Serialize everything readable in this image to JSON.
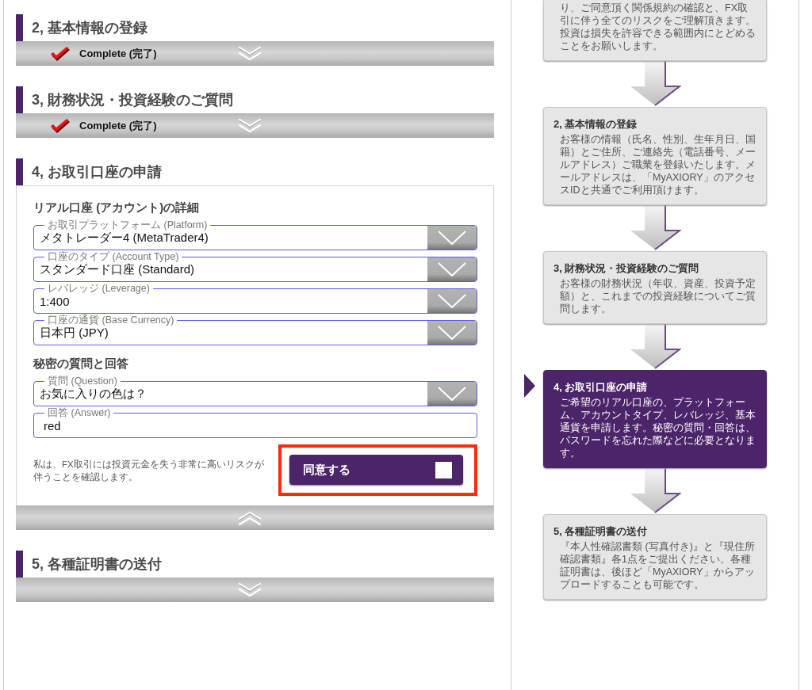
{
  "sections": [
    {
      "title": "2, 基本情報の登録",
      "expanded": false,
      "complete": true,
      "status": "Complete (完了)"
    },
    {
      "title": "3, 財務状況・投資経験のご質問",
      "expanded": false,
      "complete": true,
      "status": "Complete (完了)"
    },
    {
      "title": "4, お取引口座の申請",
      "expanded": true,
      "complete": false,
      "form": {
        "groups": [
          {
            "heading": "リアル口座 (アカウント)の詳細",
            "fields": [
              {
                "kind": "select",
                "label": "お取引プラットフォーム (Platform)",
                "value": "メタトレーダー4 (MetaTrader4)"
              },
              {
                "kind": "select",
                "label": "口座のタイプ (Account Type)",
                "value": "スタンダード口座 (Standard)"
              },
              {
                "kind": "select",
                "label": "レバレッジ (Leverage)",
                "value": "1:400"
              },
              {
                "kind": "select",
                "label": "口座の通貨 (Base Currency)",
                "value": "日本円 (JPY)"
              }
            ]
          },
          {
            "heading": "秘密の質問と回答",
            "fields": [
              {
                "kind": "select",
                "label": "質問 (Question)",
                "value": "お気に入りの色は？"
              },
              {
                "kind": "text",
                "label": "回答 (Answer)",
                "value": "red"
              }
            ]
          }
        ],
        "agreement": {
          "statement": "私は、FX取引には投資元金を失う非常に高いリスクが伴うことを確認します。",
          "button_label": "同意する",
          "checked": false,
          "highlighted": true
        }
      }
    },
    {
      "title": "5, 各種証明書の送付",
      "expanded": false,
      "complete": false
    }
  ],
  "steps": [
    {
      "cut": true,
      "selected": false,
      "body": "り、ご同意頂く関係規約の確認と、FX取引に伴う全てのリスクをご理解頂きます。投資は損失を許容できる範囲内にとどめることをお願いします。"
    },
    {
      "cut": false,
      "selected": false,
      "title": "2, 基本情報の登録",
      "body": "お客様の情報（氏名、性別、生年月日、国籍）とご住所、ご連絡先（電話番号、メールアドレス）ご職業を登録いたします。メールアドレスは、「MyAXIORY」のアクセスIDと共通でご利用頂けます。"
    },
    {
      "cut": false,
      "selected": false,
      "title": "3, 財務状況・投資経験のご質問",
      "body": "お客様の財務状況（年収、資産、投資予定額）と、これまでの投資経験についてご質問します。"
    },
    {
      "cut": false,
      "selected": true,
      "title": "4, お取引口座の申請",
      "body": "ご希望のリアル口座の、プラットフォーム、アカウントタイプ、レバレッジ、基本通貨を申請します。秘密の質問・回答は、パスワードを忘れた際などに必要となります。"
    },
    {
      "cut": false,
      "selected": false,
      "title": "5, 各種証明書の送付",
      "body": "『本人性確認書類 (写真付き)』と『現住所確認書類』各1点をご提出ください。各種証明書は、後ほど「MyAXIORY」からアップロードすることも可能です。"
    }
  ]
}
